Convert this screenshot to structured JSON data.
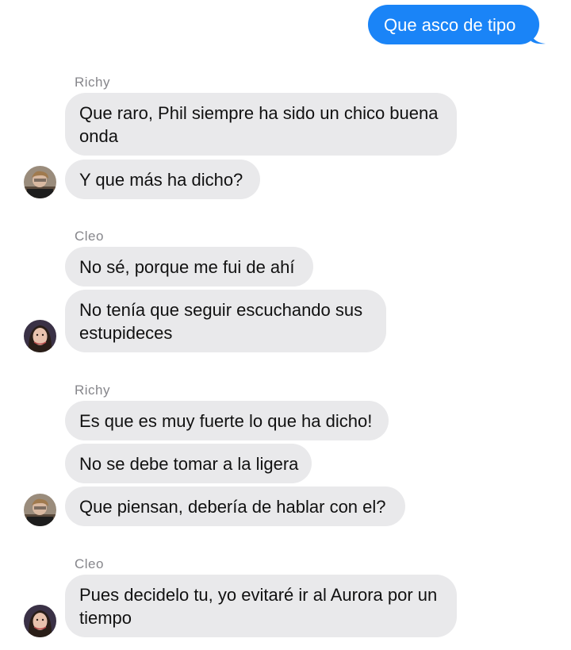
{
  "colors": {
    "outgoing_bubble": "#1a84f7",
    "incoming_bubble": "#e9e9eb",
    "sender_name": "#86868b"
  },
  "messages": {
    "m0": "Que asco de tipo",
    "m1": "Que raro, Phil siempre ha sido un chico buena onda",
    "m2": "Y que más ha dicho?",
    "m3": "No sé, porque me fui de ahí",
    "m4": "No tenía que seguir escuchando sus estupideces",
    "m5": "Es que es muy fuerte lo que ha dicho!",
    "m6": "No se debe tomar a la ligera",
    "m7": "Que piensan, debería de hablar con el?",
    "m8": "Pues decidelo tu, yo evitaré ir al Aurora por un tiempo"
  },
  "senders": {
    "s1": "Richy",
    "s2": "Cleo",
    "s3": "Richy",
    "s4": "Cleo"
  },
  "avatars": {
    "richy": "person-avatar-icon",
    "cleo": "person-avatar-icon"
  }
}
